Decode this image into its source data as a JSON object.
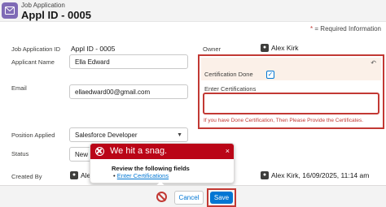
{
  "header": {
    "object_name": "Job Application",
    "record_title": "Appl ID - 0005"
  },
  "required_info": "= Required Information",
  "fields": {
    "job_application_id": {
      "label": "Job Application ID",
      "value": "Appl ID - 0005"
    },
    "applicant_name": {
      "label": "Applicant Name",
      "value": "Ella Edward"
    },
    "email": {
      "label": "Email",
      "value": "ellaedward00@gmail.com"
    },
    "position_applied": {
      "label": "Position Applied",
      "value": "Salesforce Developer"
    },
    "status": {
      "label": "Status",
      "value": "New"
    },
    "created_by": {
      "label": "Created By",
      "value": "Ale"
    },
    "owner": {
      "label": "Owner",
      "value": "Alex Kirk"
    },
    "last_modified": {
      "value": "Alex Kirk, 16/09/2025, 11:14 am"
    }
  },
  "certification": {
    "done_label": "Certification Done",
    "done_checked": true,
    "certifications_label": "Enter Certifications",
    "certifications_value": "",
    "error_text": "If you have Done Certification, Then Please Provide the Certificates."
  },
  "popover": {
    "title": "We hit a snag.",
    "review_text": "Review the following fields",
    "link_text": "Enter Certifications",
    "close_glyph": "×"
  },
  "footer": {
    "cancel_label": "Cancel",
    "save_label": "Save"
  },
  "colors": {
    "error_red": "#c23934",
    "brand_blue": "#0176d3",
    "object_icon": "#7f6bb6"
  }
}
